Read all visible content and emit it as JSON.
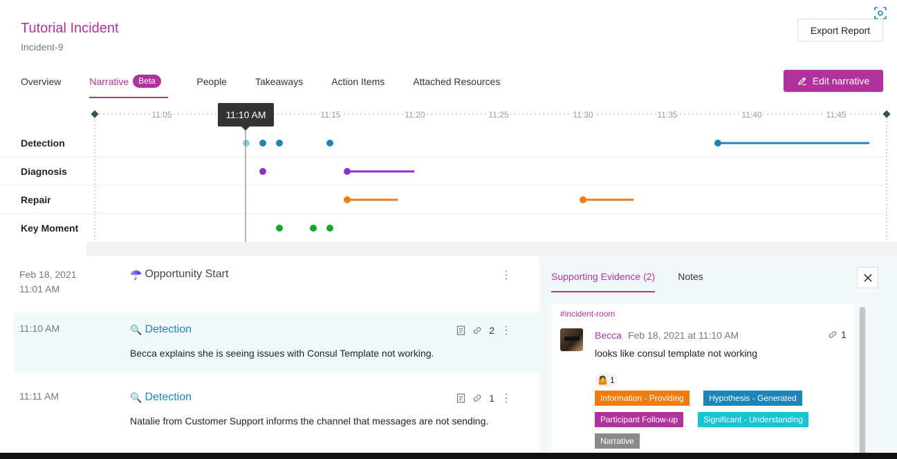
{
  "header": {
    "title": "Tutorial Incident",
    "subtitle": "Incident-9",
    "export_label": "Export Report",
    "edit_label": "Edit narrative"
  },
  "tabs": [
    {
      "label": "Overview"
    },
    {
      "label": "Narrative",
      "badge": "Beta",
      "active": true
    },
    {
      "label": "People"
    },
    {
      "label": "Takeaways"
    },
    {
      "label": "Action Items"
    },
    {
      "label": "Attached Resources"
    }
  ],
  "timeline": {
    "ticks": [
      "11:05",
      "11:10",
      "11:15",
      "11:20",
      "11:25",
      "11:30",
      "11:35",
      "11:40",
      "11:45"
    ],
    "tooltip": "11:10 AM",
    "rows": [
      "Detection",
      "Diagnosis",
      "Repair",
      "Key Moment"
    ],
    "colors": {
      "Detection": "#1a85b8",
      "Diagnosis": "#8c2fd0",
      "Repair": "#f07c10",
      "Key Moment": "#17a62c"
    }
  },
  "entries": [
    {
      "date": "Feb 18, 2021",
      "time": "11:01 AM",
      "icon": "☂️",
      "title": "Opportunity Start",
      "desc": ""
    },
    {
      "date": "",
      "time": "11:10 AM",
      "icon": "🔍",
      "title": "Detection",
      "desc": "Becca explains she is seeing issues with Consul Template not working.",
      "links": "2"
    },
    {
      "date": "",
      "time": "11:11 AM",
      "icon": "🔍",
      "title": "Detection",
      "desc": "Natalie from Customer Support informs the channel that messages are not sending.",
      "links": "1"
    }
  ],
  "panel": {
    "tab_evidence": "Supporting Evidence (2)",
    "tab_notes": "Notes",
    "channel": "#incident-room",
    "author": "Becca",
    "date": "Feb 18, 2021 at 11:10 AM",
    "message": "looks like consul template not working",
    "link_count": "1",
    "reaction_emoji": "🤷",
    "reaction_count": "1",
    "tags": [
      {
        "label": "Information - Providing",
        "color": "#f07c10"
      },
      {
        "label": "Hypothesis - Generated",
        "color": "#1a85b8"
      },
      {
        "label": "Participant Follow-up",
        "color": "#b0329c"
      },
      {
        "label": "Significant - Understanding",
        "color": "#17c4d4"
      },
      {
        "label": "Narrative",
        "color": "#8a8a8a"
      }
    ]
  }
}
